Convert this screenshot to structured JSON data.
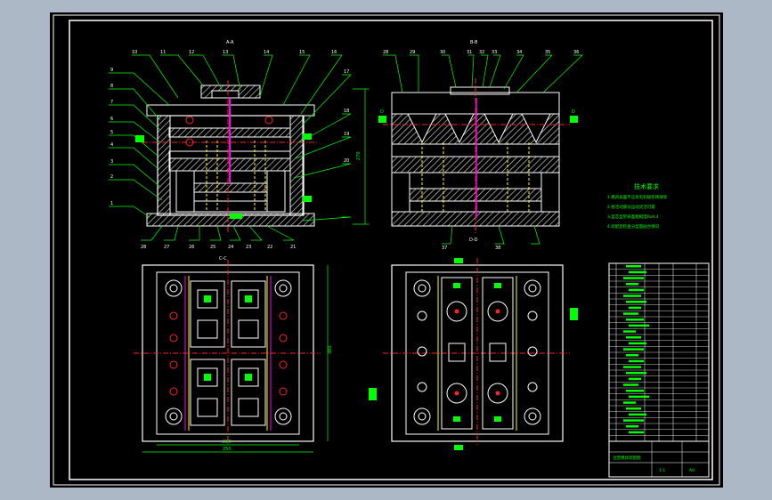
{
  "colors": {
    "window_bg": "#adb8c6",
    "canvas_bg": "#000000",
    "outline": "#ffffff",
    "leader": "#00ff00",
    "centerline": "#ff2020",
    "hatch": "#c8c8c8",
    "highlight_yellow": "#ffff00",
    "highlight_magenta": "#ff00ff"
  },
  "views": {
    "section_a_label": "A-A",
    "section_b_label": "B-B",
    "section_c_label": "C-C",
    "section_d_label": "D-D",
    "marker_d": "D",
    "dim_height": "270",
    "dim_plan_height": "300",
    "dim_plan_width_inner": "220",
    "dim_plan_width_outer": "250"
  },
  "callouts_left": [
    "9",
    "8",
    "7",
    "6",
    "5",
    "4",
    "3",
    "2",
    "1",
    "10",
    "11",
    "12",
    "13",
    "14",
    "15",
    "16",
    "17",
    "18",
    "19",
    "20",
    "21",
    "22",
    "23",
    "24",
    "25",
    "26",
    "27",
    "28"
  ],
  "callouts_right": [
    "28",
    "29",
    "30",
    "31",
    "32",
    "33",
    "34",
    "35",
    "36",
    "37",
    "38"
  ],
  "tech_requirements": {
    "title": "技术要求",
    "lines": [
      "1.模具表面不应有毛刺碰伤锈蚀等",
      "2.各活动部分运动灵活可靠",
      "3.型芯型腔表面粗糙度Ra0.4",
      "4.装配后检查分型面贴合情况"
    ]
  },
  "title_block": {
    "drawing_name": "注塑模具装配图",
    "scale": "1:1",
    "sheet": "A0"
  },
  "bom_rows": 30
}
